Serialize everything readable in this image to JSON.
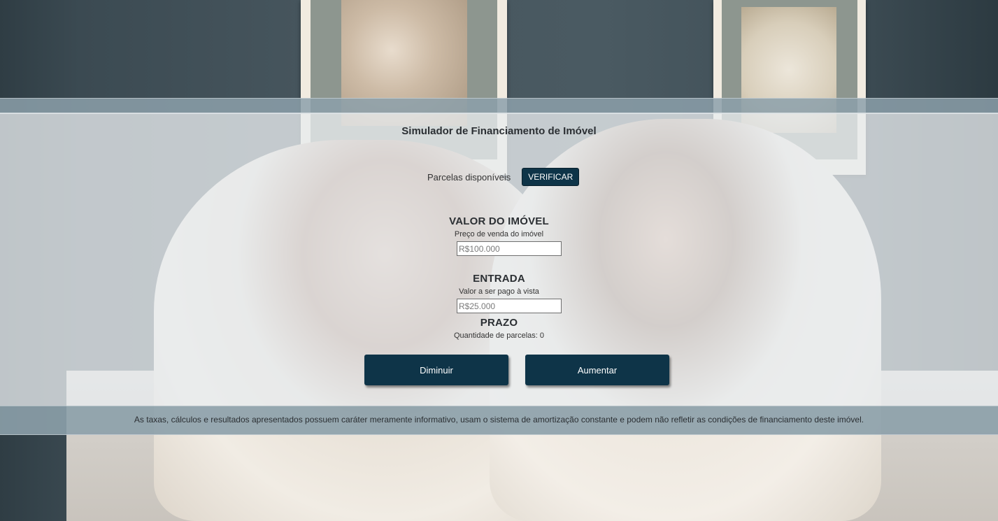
{
  "page": {
    "title": "Simulador de Financiamento de Imóvel"
  },
  "verify": {
    "label": "Parcelas disponíveis",
    "button_label": "VERIFICAR"
  },
  "property_value": {
    "heading": "VALOR DO IMÓVEL",
    "subheading": "Preço de venda do imóvel",
    "placeholder": "R$100.000"
  },
  "down_payment": {
    "heading": "ENTRADA",
    "subheading": "Valor a ser pago à vista",
    "placeholder": "R$25.000"
  },
  "term": {
    "heading": "PRAZO",
    "installments_text": "Quantidade de parcelas: 0"
  },
  "actions": {
    "decrease_label": "Diminuir",
    "increase_label": "Aumentar"
  },
  "footer": {
    "disclaimer": "As taxas, cálculos e resultados apresentados possuem caráter meramente informativo, usam o sistema de amortização constante e podem não refletir as condições de financiamento deste imóvel."
  },
  "colors": {
    "button_bg": "#0e3448",
    "stripe": "#8ca0aa"
  }
}
